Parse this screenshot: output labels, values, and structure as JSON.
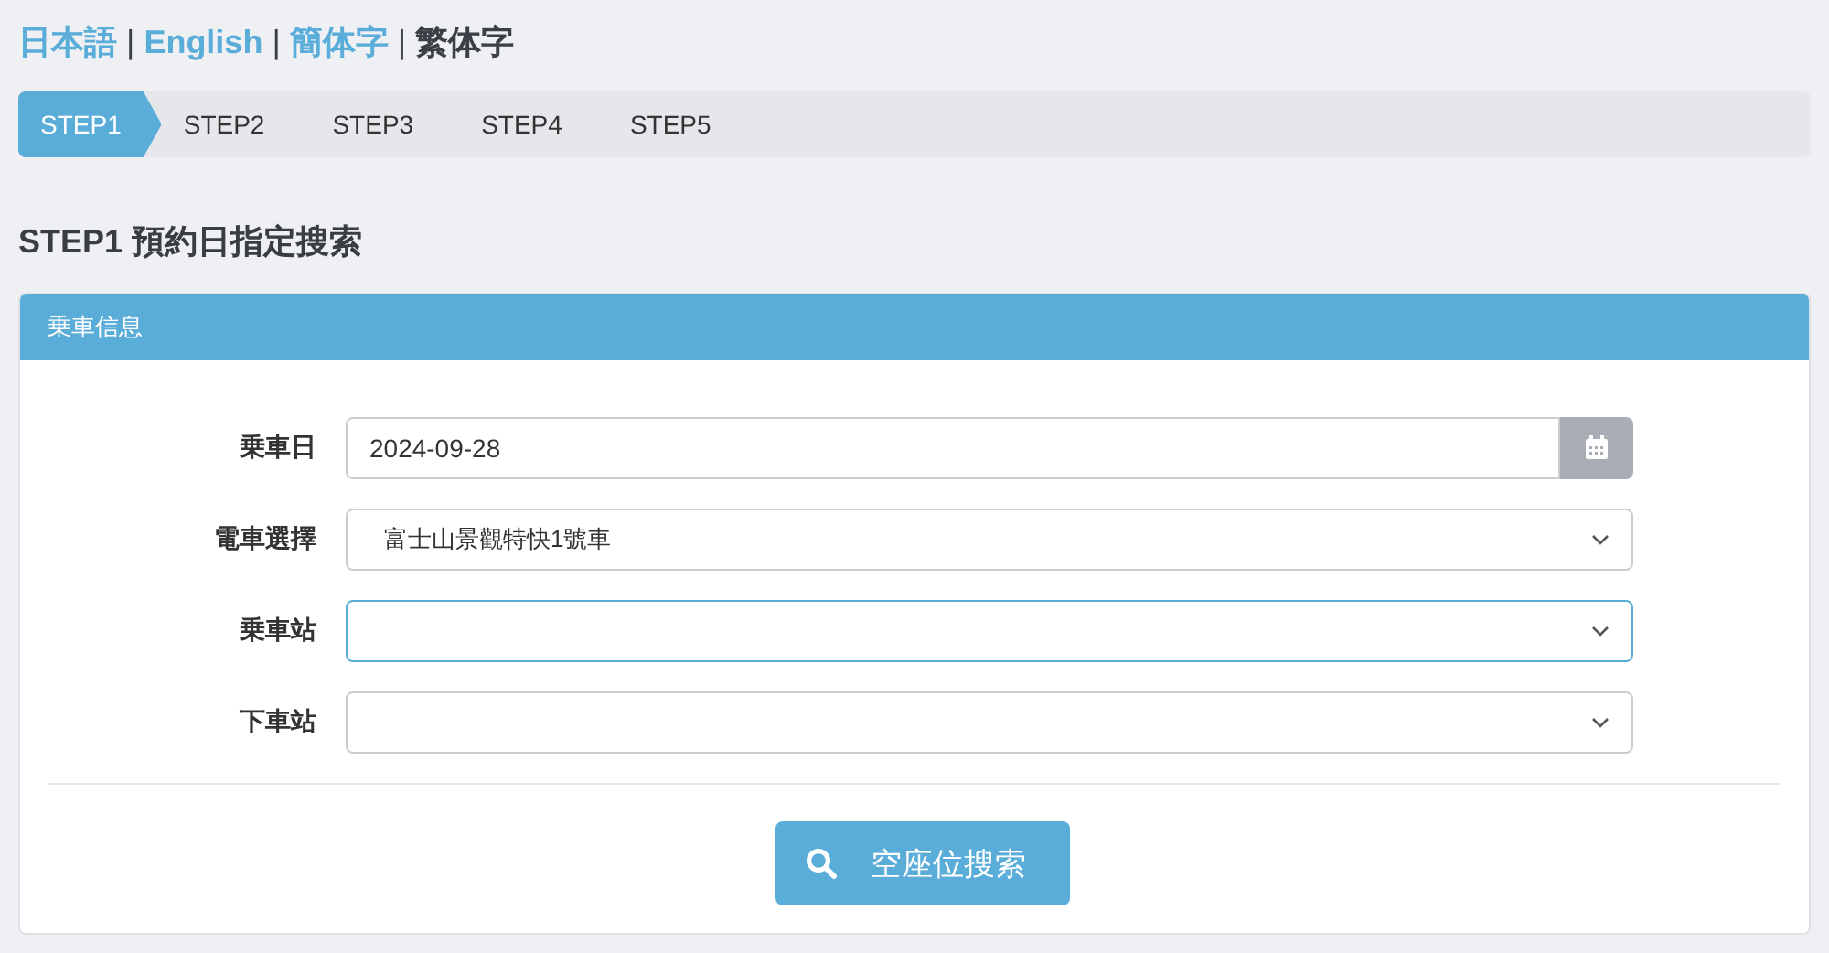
{
  "languages": [
    {
      "label": "日本語",
      "selected": false
    },
    {
      "label": "English",
      "selected": false
    },
    {
      "label": "簡体字",
      "selected": false
    },
    {
      "label": "繁体字",
      "selected": true
    }
  ],
  "language_separator": "|",
  "steps": [
    {
      "label": "STEP1",
      "selected": true
    },
    {
      "label": "STEP2",
      "selected": false
    },
    {
      "label": "STEP3",
      "selected": false
    },
    {
      "label": "STEP4",
      "selected": false
    },
    {
      "label": "STEP5",
      "selected": false
    }
  ],
  "heading": "STEP1 預約日指定搜索",
  "panel": {
    "title": "乗車信息",
    "fields": [
      {
        "label": "乗車日",
        "kind": "date",
        "value": "2024-09-28",
        "focused": false
      },
      {
        "label": "電車選擇",
        "kind": "select",
        "value": "富士山景觀特快1號車",
        "focused": false
      },
      {
        "label": "乗車站",
        "kind": "select",
        "focused": true
      },
      {
        "label": "下車站",
        "kind": "select",
        "focused": false
      }
    ],
    "search_button": "空座位搜索"
  }
}
